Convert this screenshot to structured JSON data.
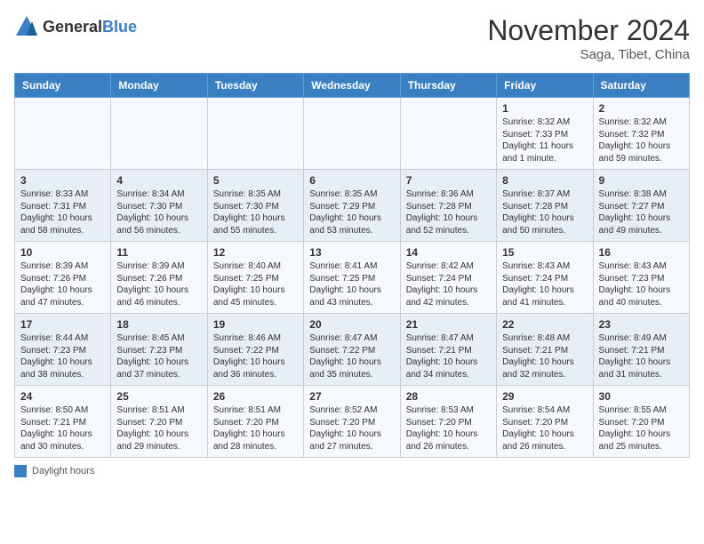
{
  "header": {
    "logo_general": "General",
    "logo_blue": "Blue",
    "month": "November 2024",
    "location": "Saga, Tibet, China"
  },
  "weekdays": [
    "Sunday",
    "Monday",
    "Tuesday",
    "Wednesday",
    "Thursday",
    "Friday",
    "Saturday"
  ],
  "weeks": [
    [
      {
        "day": "",
        "info": ""
      },
      {
        "day": "",
        "info": ""
      },
      {
        "day": "",
        "info": ""
      },
      {
        "day": "",
        "info": ""
      },
      {
        "day": "",
        "info": ""
      },
      {
        "day": "1",
        "info": "Sunrise: 8:32 AM\nSunset: 7:33 PM\nDaylight: 11 hours and 1 minute."
      },
      {
        "day": "2",
        "info": "Sunrise: 8:32 AM\nSunset: 7:32 PM\nDaylight: 10 hours and 59 minutes."
      }
    ],
    [
      {
        "day": "3",
        "info": "Sunrise: 8:33 AM\nSunset: 7:31 PM\nDaylight: 10 hours and 58 minutes."
      },
      {
        "day": "4",
        "info": "Sunrise: 8:34 AM\nSunset: 7:30 PM\nDaylight: 10 hours and 56 minutes."
      },
      {
        "day": "5",
        "info": "Sunrise: 8:35 AM\nSunset: 7:30 PM\nDaylight: 10 hours and 55 minutes."
      },
      {
        "day": "6",
        "info": "Sunrise: 8:35 AM\nSunset: 7:29 PM\nDaylight: 10 hours and 53 minutes."
      },
      {
        "day": "7",
        "info": "Sunrise: 8:36 AM\nSunset: 7:28 PM\nDaylight: 10 hours and 52 minutes."
      },
      {
        "day": "8",
        "info": "Sunrise: 8:37 AM\nSunset: 7:28 PM\nDaylight: 10 hours and 50 minutes."
      },
      {
        "day": "9",
        "info": "Sunrise: 8:38 AM\nSunset: 7:27 PM\nDaylight: 10 hours and 49 minutes."
      }
    ],
    [
      {
        "day": "10",
        "info": "Sunrise: 8:39 AM\nSunset: 7:26 PM\nDaylight: 10 hours and 47 minutes."
      },
      {
        "day": "11",
        "info": "Sunrise: 8:39 AM\nSunset: 7:26 PM\nDaylight: 10 hours and 46 minutes."
      },
      {
        "day": "12",
        "info": "Sunrise: 8:40 AM\nSunset: 7:25 PM\nDaylight: 10 hours and 45 minutes."
      },
      {
        "day": "13",
        "info": "Sunrise: 8:41 AM\nSunset: 7:25 PM\nDaylight: 10 hours and 43 minutes."
      },
      {
        "day": "14",
        "info": "Sunrise: 8:42 AM\nSunset: 7:24 PM\nDaylight: 10 hours and 42 minutes."
      },
      {
        "day": "15",
        "info": "Sunrise: 8:43 AM\nSunset: 7:24 PM\nDaylight: 10 hours and 41 minutes."
      },
      {
        "day": "16",
        "info": "Sunrise: 8:43 AM\nSunset: 7:23 PM\nDaylight: 10 hours and 40 minutes."
      }
    ],
    [
      {
        "day": "17",
        "info": "Sunrise: 8:44 AM\nSunset: 7:23 PM\nDaylight: 10 hours and 38 minutes."
      },
      {
        "day": "18",
        "info": "Sunrise: 8:45 AM\nSunset: 7:23 PM\nDaylight: 10 hours and 37 minutes."
      },
      {
        "day": "19",
        "info": "Sunrise: 8:46 AM\nSunset: 7:22 PM\nDaylight: 10 hours and 36 minutes."
      },
      {
        "day": "20",
        "info": "Sunrise: 8:47 AM\nSunset: 7:22 PM\nDaylight: 10 hours and 35 minutes."
      },
      {
        "day": "21",
        "info": "Sunrise: 8:47 AM\nSunset: 7:21 PM\nDaylight: 10 hours and 34 minutes."
      },
      {
        "day": "22",
        "info": "Sunrise: 8:48 AM\nSunset: 7:21 PM\nDaylight: 10 hours and 32 minutes."
      },
      {
        "day": "23",
        "info": "Sunrise: 8:49 AM\nSunset: 7:21 PM\nDaylight: 10 hours and 31 minutes."
      }
    ],
    [
      {
        "day": "24",
        "info": "Sunrise: 8:50 AM\nSunset: 7:21 PM\nDaylight: 10 hours and 30 minutes."
      },
      {
        "day": "25",
        "info": "Sunrise: 8:51 AM\nSunset: 7:20 PM\nDaylight: 10 hours and 29 minutes."
      },
      {
        "day": "26",
        "info": "Sunrise: 8:51 AM\nSunset: 7:20 PM\nDaylight: 10 hours and 28 minutes."
      },
      {
        "day": "27",
        "info": "Sunrise: 8:52 AM\nSunset: 7:20 PM\nDaylight: 10 hours and 27 minutes."
      },
      {
        "day": "28",
        "info": "Sunrise: 8:53 AM\nSunset: 7:20 PM\nDaylight: 10 hours and 26 minutes."
      },
      {
        "day": "29",
        "info": "Sunrise: 8:54 AM\nSunset: 7:20 PM\nDaylight: 10 hours and 26 minutes."
      },
      {
        "day": "30",
        "info": "Sunrise: 8:55 AM\nSunset: 7:20 PM\nDaylight: 10 hours and 25 minutes."
      }
    ]
  ],
  "legend": {
    "label": "Daylight hours"
  }
}
